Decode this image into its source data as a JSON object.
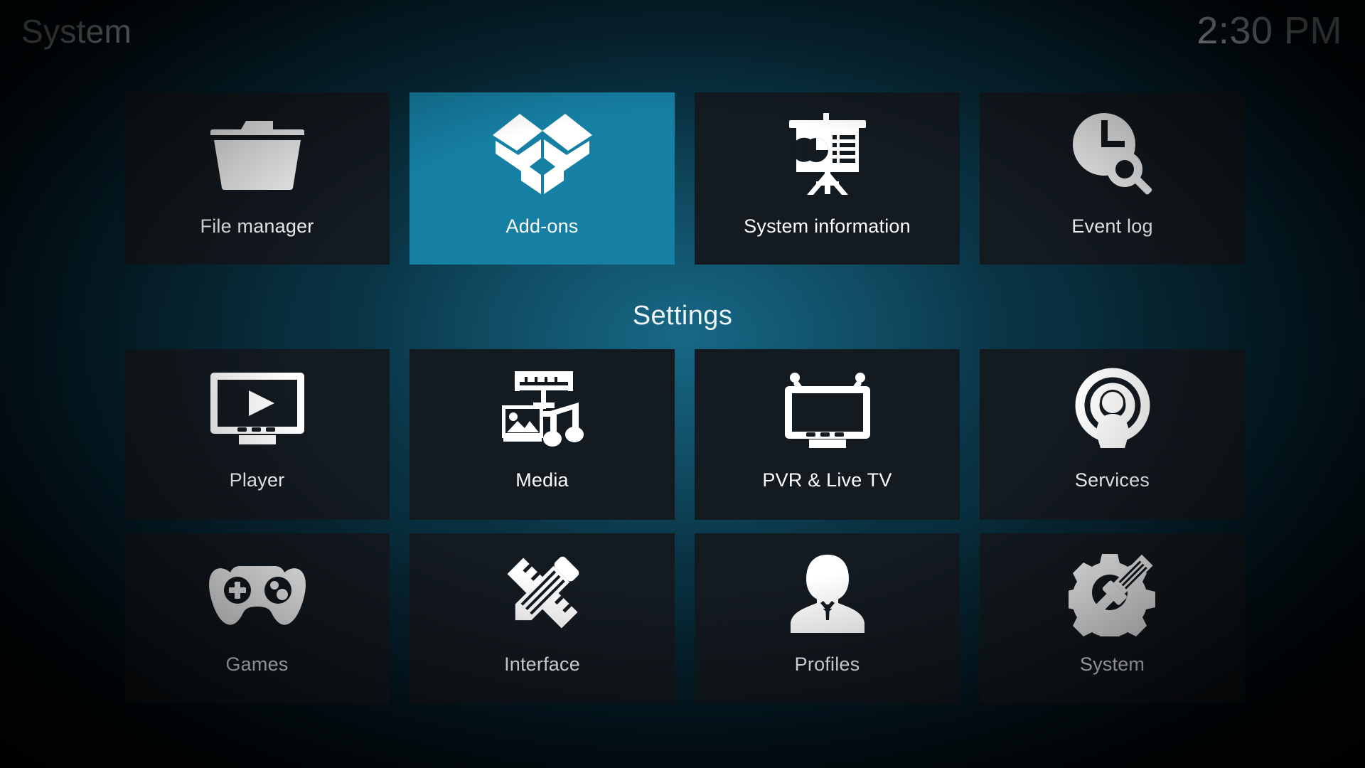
{
  "header": {
    "title": "System",
    "clock": "2:30 PM"
  },
  "sections": {
    "settings_heading": "Settings"
  },
  "colors": {
    "highlight": "#167fa4",
    "tile_background": "#131a20",
    "icon": "#ffffff",
    "text": "#ffffff",
    "background_teal": "#0d4356"
  },
  "top_row": {
    "items": [
      {
        "label": "File manager",
        "icon": "folder-icon",
        "selected": false
      },
      {
        "label": "Add-ons",
        "icon": "open-box-icon",
        "selected": true
      },
      {
        "label": "System information",
        "icon": "presentation-icon",
        "selected": false
      },
      {
        "label": "Event log",
        "icon": "clock-search-icon",
        "selected": false
      }
    ]
  },
  "settings_row_1": {
    "items": [
      {
        "label": "Player",
        "icon": "monitor-play-icon",
        "selected": false
      },
      {
        "label": "Media",
        "icon": "media-library-icon",
        "selected": false
      },
      {
        "label": "PVR & Live TV",
        "icon": "tv-antenna-icon",
        "selected": false
      },
      {
        "label": "Services",
        "icon": "broadcast-icon",
        "selected": false
      }
    ]
  },
  "settings_row_2": {
    "items": [
      {
        "label": "Games",
        "icon": "gamepad-icon",
        "selected": false
      },
      {
        "label": "Interface",
        "icon": "pencil-ruler-icon",
        "selected": false
      },
      {
        "label": "Profiles",
        "icon": "person-bust-icon",
        "selected": false
      },
      {
        "label": "System",
        "icon": "gear-screwdriver-icon",
        "selected": false
      }
    ]
  }
}
